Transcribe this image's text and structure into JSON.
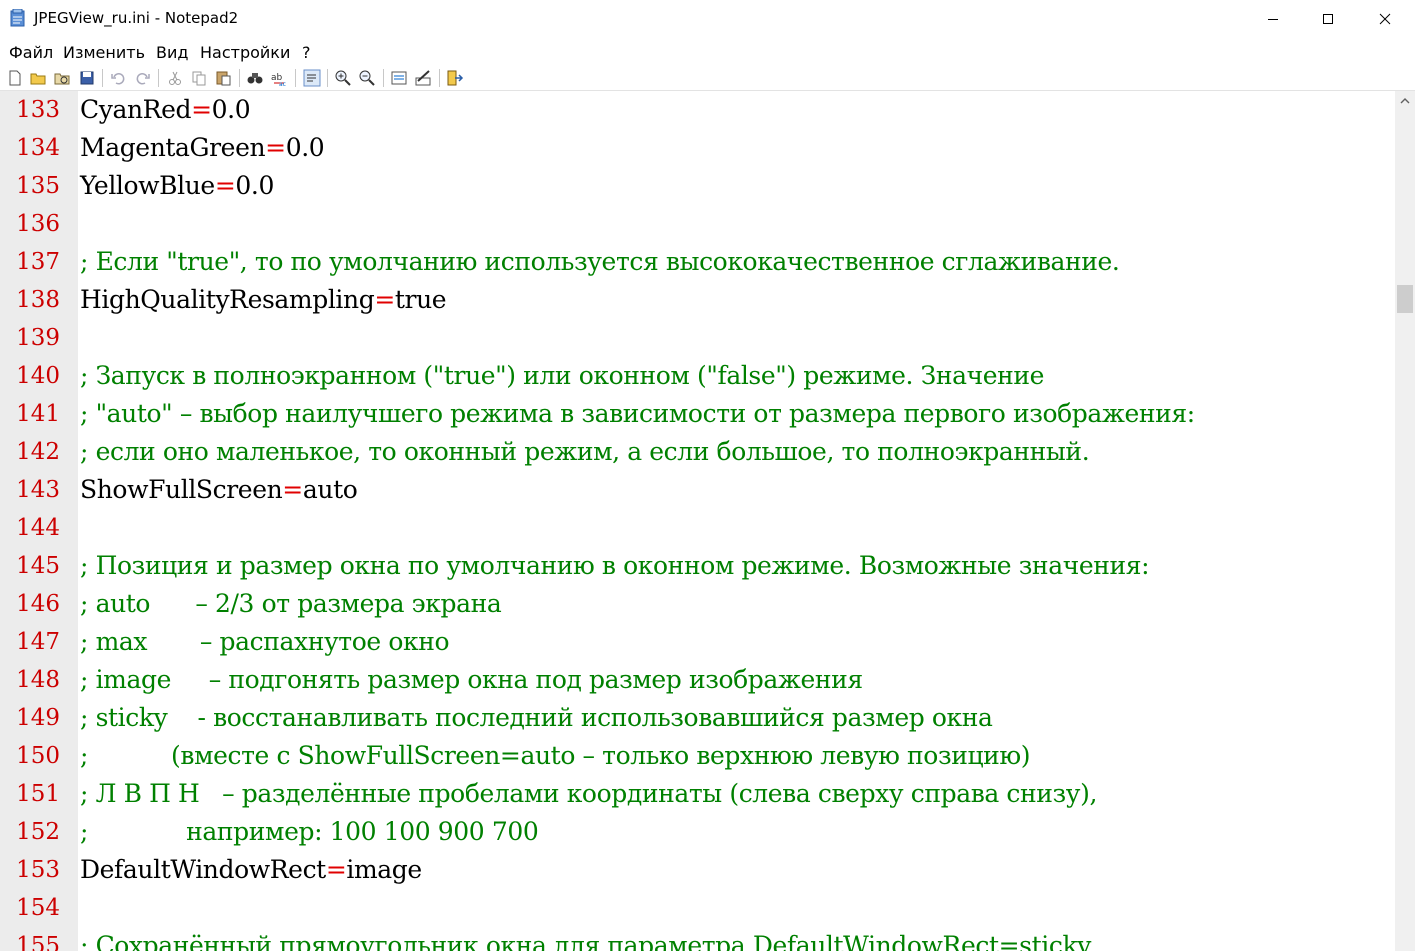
{
  "window": {
    "title": "JPEGView_ru.ini - Notepad2"
  },
  "menu": {
    "items": [
      "Файл",
      "Изменить",
      "Вид",
      "Настройки",
      "?"
    ]
  },
  "toolbar": {
    "icons": [
      "new-file-icon",
      "open-file-icon",
      "browse-icon",
      "save-icon",
      "undo-icon",
      "redo-icon",
      "cut-icon",
      "copy-icon",
      "paste-icon",
      "find-icon",
      "replace-icon",
      "word-wrap-icon",
      "zoom-in-icon",
      "zoom-out-icon",
      "select-scheme-icon",
      "customize-schemes-icon",
      "exit-icon"
    ]
  },
  "editor": {
    "lines": [
      {
        "n": "133",
        "type": "kv",
        "key": "CyanRed",
        "eq": "=",
        "val": "0.0"
      },
      {
        "n": "134",
        "type": "kv",
        "key": "MagentaGreen",
        "eq": "=",
        "val": "0.0"
      },
      {
        "n": "135",
        "type": "kv",
        "key": "YellowBlue",
        "eq": "=",
        "val": "0.0"
      },
      {
        "n": "136",
        "type": "empty",
        "text": ""
      },
      {
        "n": "137",
        "type": "comment",
        "text": "; Если \"true\", то по умолчанию используется высококачественное сглаживание."
      },
      {
        "n": "138",
        "type": "kv",
        "key": "HighQualityResampling",
        "eq": "=",
        "val": "true"
      },
      {
        "n": "139",
        "type": "empty",
        "text": ""
      },
      {
        "n": "140",
        "type": "comment",
        "text": "; Запуск в полноэкранном (\"true\") или оконном (\"false\") режиме. Значение"
      },
      {
        "n": "141",
        "type": "comment",
        "text": "; \"auto\" – выбор наилучшего режима в зависимости от размера первого изображения:"
      },
      {
        "n": "142",
        "type": "comment",
        "text": "; если оно маленькое, то оконный режим, а если большое, то полноэкранный."
      },
      {
        "n": "143",
        "type": "kv",
        "key": "ShowFullScreen",
        "eq": "=",
        "val": "auto"
      },
      {
        "n": "144",
        "type": "empty",
        "text": ""
      },
      {
        "n": "145",
        "type": "comment",
        "text": "; Позиция и размер окна по умолчанию в оконном режиме. Возможные значения:"
      },
      {
        "n": "146",
        "type": "comment",
        "text": "; auto      – 2/3 от размера экрана"
      },
      {
        "n": "147",
        "type": "comment",
        "text": "; max       – распахнутое окно"
      },
      {
        "n": "148",
        "type": "comment",
        "text": "; image     – подгонять размер окна под размер изображения"
      },
      {
        "n": "149",
        "type": "comment",
        "text": "; sticky    - восстанавливать последний использовавшийся размер окна"
      },
      {
        "n": "150",
        "type": "comment",
        "text": ";           (вместе с ShowFullScreen=auto – только верхнюю левую позицию)"
      },
      {
        "n": "151",
        "type": "comment",
        "text": "; Л В П Н   – разделённые пробелами координаты (слева сверху справа снизу),"
      },
      {
        "n": "152",
        "type": "comment",
        "text": ";             например: 100 100 900 700"
      },
      {
        "n": "153",
        "type": "kv",
        "key": "DefaultWindowRect",
        "eq": "=",
        "val": "image"
      },
      {
        "n": "154",
        "type": "empty",
        "text": ""
      },
      {
        "n": "155",
        "type": "comment",
        "text": "; Сохранённый прямоугольник окна для параметра DefaultWindowRect=sticky"
      }
    ]
  },
  "colors": {
    "line_number": "#cc0000",
    "comment": "#008000",
    "equals": "#e00000",
    "gutter": "#ececec"
  }
}
